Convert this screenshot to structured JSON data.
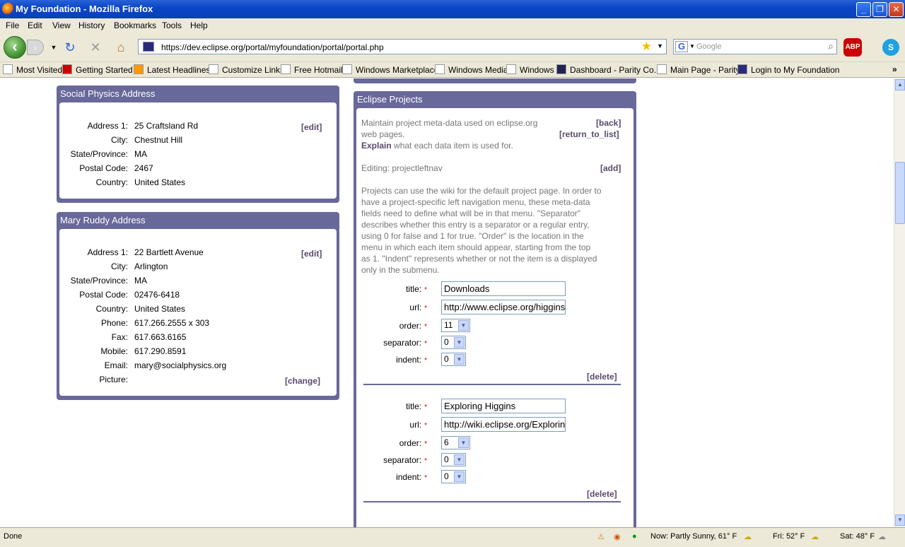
{
  "window": {
    "title": "My Foundation - Mozilla Firefox"
  },
  "menu": [
    "File",
    "Edit",
    "View",
    "History",
    "Bookmarks",
    "Tools",
    "Help"
  ],
  "address": {
    "url": "https://dev.eclipse.org/portal/myfoundation/portal/portal.php"
  },
  "search": {
    "placeholder": "Google",
    "engine": "G"
  },
  "bookmarks": [
    "Most Visited",
    "Getting Started",
    "Latest Headlines",
    "Customize Links",
    "Free Hotmail",
    "Windows Marketplace",
    "Windows Media",
    "Windows",
    "Dashboard - Parity Co...",
    "Main Page - Parity",
    "Login to My Foundation"
  ],
  "social": {
    "title": "Social Physics Address",
    "edit": "[edit]",
    "fields": [
      {
        "label": "Address 1:",
        "value": "25 Craftsland Rd"
      },
      {
        "label": "City:",
        "value": "Chestnut Hill"
      },
      {
        "label": "State/Province:",
        "value": "MA"
      },
      {
        "label": "Postal Code:",
        "value": "2467"
      },
      {
        "label": "Country:",
        "value": "United States"
      }
    ]
  },
  "mary": {
    "title": "Mary Ruddy Address",
    "edit": "[edit]",
    "change": "[change]",
    "fields": [
      {
        "label": "Address 1:",
        "value": "22 Bartlett Avenue"
      },
      {
        "label": "City:",
        "value": "Arlington"
      },
      {
        "label": "State/Province:",
        "value": "MA"
      },
      {
        "label": "Postal Code:",
        "value": "02476-6418"
      },
      {
        "label": "Country:",
        "value": "United States"
      },
      {
        "label": "Phone:",
        "value": "617.266.2555 x 303"
      },
      {
        "label": "Fax:",
        "value": "617.663.6165"
      },
      {
        "label": "Mobile:",
        "value": "617.290.8591"
      },
      {
        "label": "Email:",
        "value": "mary@socialphysics.org"
      },
      {
        "label": "Picture:",
        "value": ""
      }
    ]
  },
  "eclipse": {
    "title": "Eclipse Projects",
    "intro1": "Maintain project meta-data used on eclipse.org",
    "intro2": "web pages.",
    "explain": "Explain",
    "explain_rest": " what each data item is used for.",
    "back": "[back]",
    "return": "[return_to_list]",
    "editing": "Editing: projectleftnav",
    "add": "[add]",
    "desc": [
      "Projects can use the wiki for the default project page. In order to",
      "have a project-specific left navigation menu, these meta-data",
      "fields need to define what will be in that menu. \"Separator\"",
      "describes whether this entry is a separator or a regular entry,",
      "using 0 for false and 1 for true. \"Order\" is the location in the",
      "menu in which each item should appear, starting from the top",
      "as 1. \"Indent\" represents whether or not the item is a displayed",
      "only in the submenu."
    ],
    "labels": {
      "title": "title:",
      "url": "url:",
      "order": "order:",
      "separator": "separator:",
      "indent": "indent:",
      "required": "*",
      "delete": "[delete]"
    },
    "entries": [
      {
        "title": "Downloads",
        "url": "http://www.eclipse.org/higgins",
        "order": "11",
        "separator": "0",
        "indent": "0"
      },
      {
        "title": "Exploring Higgins",
        "url": "http://wiki.eclipse.org/Exploring",
        "order": "6",
        "separator": "0",
        "indent": "0"
      }
    ]
  },
  "status": {
    "left": "Done",
    "weather1": "Now: Partly Sunny, 61° F",
    "weather2": "Fri: 52° F",
    "weather3": "Sat: 48° F"
  }
}
